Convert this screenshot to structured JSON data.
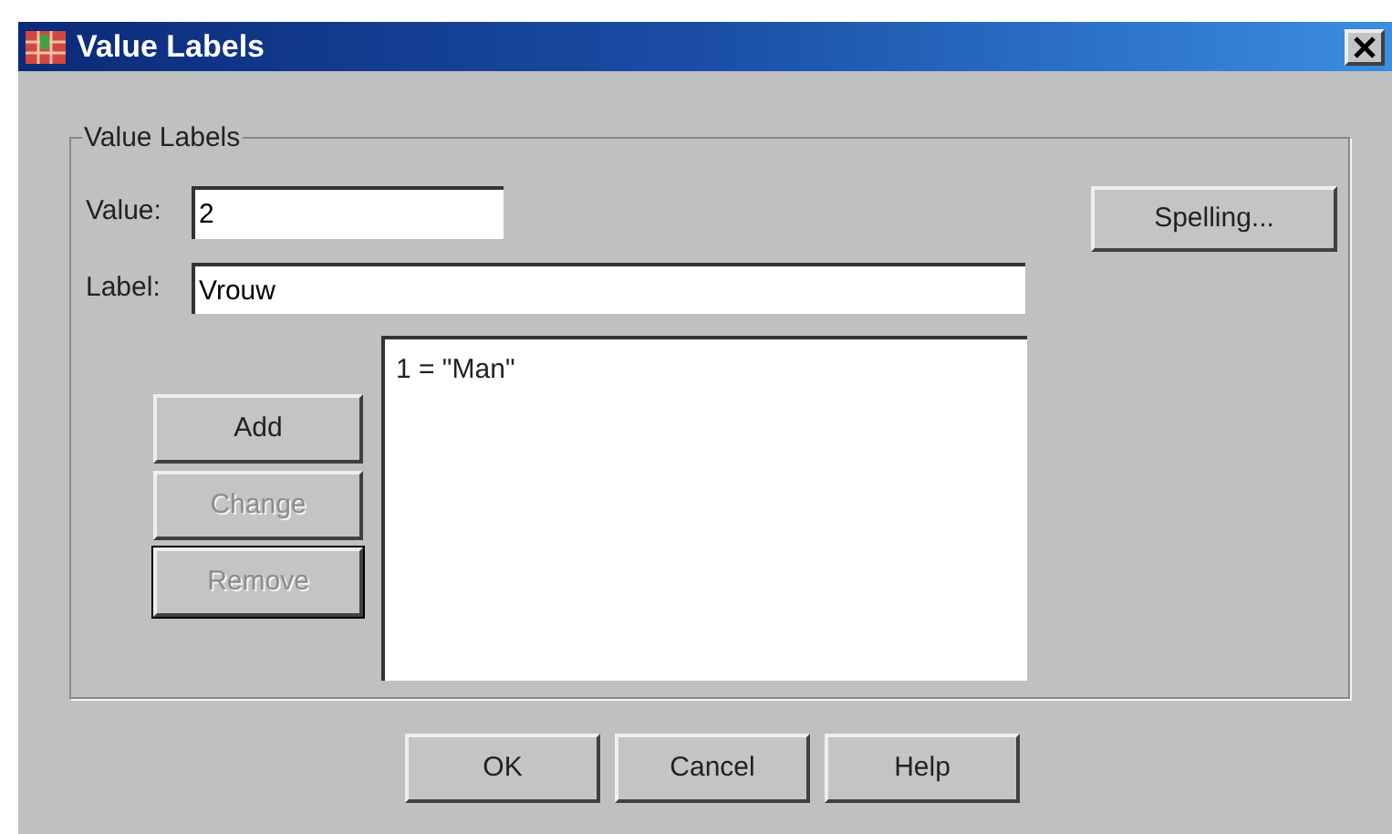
{
  "window": {
    "title": "Value Labels"
  },
  "group": {
    "title": "Value Labels"
  },
  "value_field": {
    "label": "Value:",
    "value": "2"
  },
  "label_field": {
    "label": "Label:",
    "value": "Vrouw"
  },
  "spelling_button": {
    "label": "Spelling..."
  },
  "labels_list": {
    "items": [
      {
        "text": "1 = \"Man\"",
        "selected": false
      }
    ]
  },
  "side_buttons": [
    {
      "label": "Add",
      "disabled": false,
      "default": false
    },
    {
      "label": "Change",
      "disabled": true,
      "default": false
    },
    {
      "label": "Remove",
      "disabled": true,
      "default": true
    }
  ],
  "footer_buttons": [
    "OK",
    "Cancel",
    "Help"
  ]
}
